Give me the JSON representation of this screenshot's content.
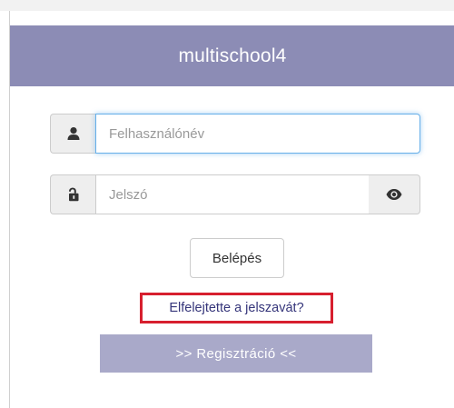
{
  "header": {
    "title": "multischool4"
  },
  "login_form": {
    "username": {
      "icon": "user-icon",
      "placeholder": "Felhasználónév",
      "value": ""
    },
    "password": {
      "icon": "lock-icon",
      "placeholder": "Jelszó",
      "value": "",
      "toggle_icon": "eye-icon"
    },
    "login_label": "Belépés",
    "forgot_label": "Elfelejtette a jelszavát?",
    "register_label": ">> Regisztráció <<"
  },
  "colors": {
    "header_bg": "#8c8cb5",
    "register_bg": "#a9a9c9",
    "highlight_border": "#d71f2e",
    "focus_border": "#66afe9",
    "link": "#35357a"
  }
}
